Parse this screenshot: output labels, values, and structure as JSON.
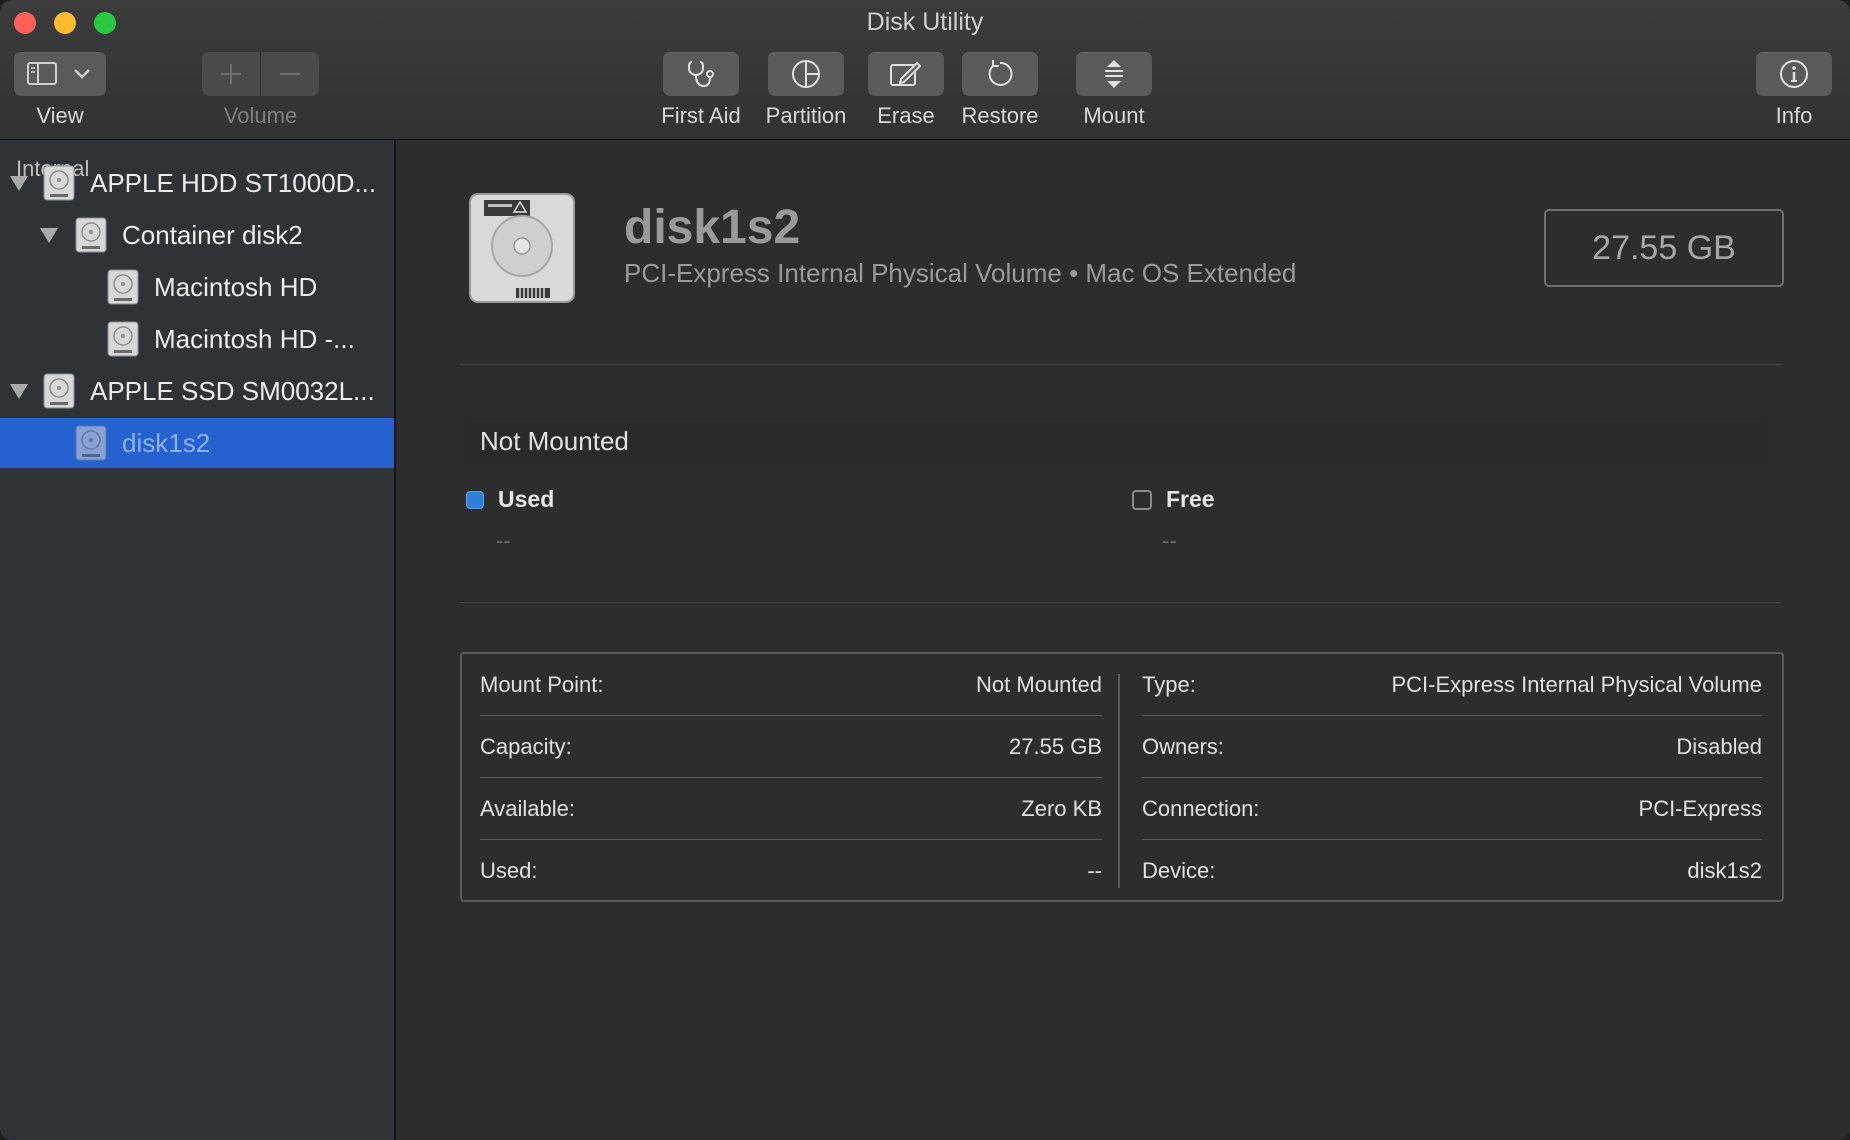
{
  "window": {
    "title": "Disk Utility"
  },
  "toolbar": {
    "view_label": "View",
    "volume_label": "Volume",
    "first_aid_label": "First Aid",
    "partition_label": "Partition",
    "erase_label": "Erase",
    "restore_label": "Restore",
    "mount_label": "Mount",
    "info_label": "Info"
  },
  "sidebar": {
    "section": "Internal",
    "items": [
      {
        "label": "APPLE HDD ST1000D...",
        "icon": "hard-drive-icon",
        "expanded": true,
        "level": 0
      },
      {
        "label": "Container disk2",
        "icon": "hard-drive-icon",
        "expanded": true,
        "level": 1
      },
      {
        "label": "Macintosh HD",
        "icon": "hard-drive-icon",
        "level": 2
      },
      {
        "label": "Macintosh HD -...",
        "icon": "hard-drive-icon",
        "level": 2
      },
      {
        "label": "APPLE SSD SM0032L...",
        "icon": "hard-drive-icon",
        "expanded": true,
        "level": 0
      },
      {
        "label": "disk1s2",
        "icon": "hard-drive-icon",
        "level": 1,
        "selected": true
      }
    ]
  },
  "detail": {
    "name": "disk1s2",
    "subtitle": "PCI-Express Internal Physical Volume • Mac OS Extended",
    "size": "27.55 GB",
    "mount_status": "Not Mounted",
    "used": {
      "label": "Used",
      "value": "--",
      "color": "#2d7fd8"
    },
    "free": {
      "label": "Free",
      "value": "--",
      "color": "#3a3a3a"
    }
  },
  "info": {
    "left": [
      {
        "key": "Mount Point:",
        "value": "Not Mounted"
      },
      {
        "key": "Capacity:",
        "value": "27.55 GB"
      },
      {
        "key": "Available:",
        "value": "Zero KB"
      },
      {
        "key": "Used:",
        "value": "--"
      }
    ],
    "right": [
      {
        "key": "Type:",
        "value": "PCI-Express Internal Physical Volume"
      },
      {
        "key": "Owners:",
        "value": "Disabled"
      },
      {
        "key": "Connection:",
        "value": "PCI-Express"
      },
      {
        "key": "Device:",
        "value": "disk1s2"
      }
    ]
  },
  "colors": {
    "selection": "#2661d0",
    "sidebar_bg": "#2f3236",
    "main_bg": "#2d2d2d"
  }
}
